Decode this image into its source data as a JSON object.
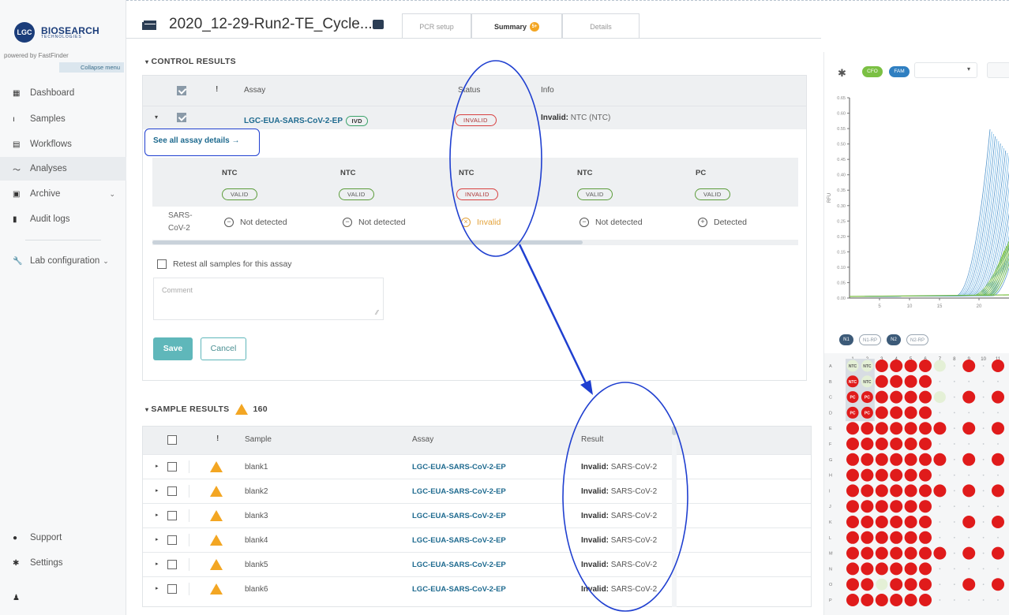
{
  "app": {
    "logo_mark": "LGC",
    "logo_name": "BIOSEARCH",
    "logo_sub": "TECHNOLOGIES",
    "powered_by": "powered by FastFinder",
    "collapse_label": "Collapse menu"
  },
  "sidebar": {
    "items": [
      {
        "label": "Dashboard",
        "icon": "dashboard-icon"
      },
      {
        "label": "Samples",
        "icon": "samples-icon"
      },
      {
        "label": "Workflows",
        "icon": "workflows-icon"
      },
      {
        "label": "Analyses",
        "icon": "analyses-icon"
      },
      {
        "label": "Archive",
        "icon": "archive-icon"
      },
      {
        "label": "Audit logs",
        "icon": "audit-logs-icon"
      },
      {
        "label": "Lab configuration",
        "icon": "wrench-icon"
      }
    ],
    "bottom": [
      {
        "label": "Support",
        "icon": "help-icon"
      },
      {
        "label": "Settings",
        "icon": "gear-icon"
      }
    ]
  },
  "header": {
    "run_title": "2020_12-29-Run2-TE_Cycle...",
    "tabs": [
      {
        "label": "PCR setup"
      },
      {
        "label": "Summary",
        "badge": "5+"
      },
      {
        "label": "Details"
      }
    ]
  },
  "control_results": {
    "title": "CONTROL RESULTS",
    "headers": {
      "flag": "!",
      "assay": "Assay",
      "status": "Status",
      "info": "Info"
    },
    "row": {
      "assay": "LGC-EUA-SARS-CoV-2-EP",
      "assay_tag": "IVD",
      "status": "INVALID",
      "info_bold": "Invalid:",
      "info_text": "NTC (NTC)"
    },
    "see_all": "See all assay details →",
    "columns": [
      {
        "name": "NTC",
        "status": "VALID",
        "result": "Not detected",
        "kind": "not"
      },
      {
        "name": "NTC",
        "status": "VALID",
        "result": "Not detected",
        "kind": "not"
      },
      {
        "name": "NTC",
        "status": "INVALID",
        "result": "Invalid",
        "kind": "invalid"
      },
      {
        "name": "NTC",
        "status": "VALID",
        "result": "Not detected",
        "kind": "not"
      },
      {
        "name": "PC",
        "status": "VALID",
        "result": "Detected",
        "kind": "det"
      }
    ],
    "target_line1": "SARS-",
    "target_line2": "CoV-2",
    "retest_label": "Retest all samples for this assay",
    "comment_placeholder": "Comment",
    "save_label": "Save",
    "cancel_label": "Cancel"
  },
  "sample_results": {
    "title": "SAMPLE RESULTS",
    "count": "160",
    "headers": {
      "flag": "!",
      "sample": "Sample",
      "assay": "Assay",
      "result": "Result"
    },
    "rows": [
      {
        "sample": "blank1",
        "assay": "LGC-EUA-SARS-CoV-2-EP",
        "result_bold": "Invalid:",
        "result_text": "SARS-CoV-2"
      },
      {
        "sample": "blank2",
        "assay": "LGC-EUA-SARS-CoV-2-EP",
        "result_bold": "Invalid:",
        "result_text": "SARS-CoV-2"
      },
      {
        "sample": "blank3",
        "assay": "LGC-EUA-SARS-CoV-2-EP",
        "result_bold": "Invalid:",
        "result_text": "SARS-CoV-2"
      },
      {
        "sample": "blank4",
        "assay": "LGC-EUA-SARS-CoV-2-EP",
        "result_bold": "Invalid:",
        "result_text": "SARS-CoV-2"
      },
      {
        "sample": "blank5",
        "assay": "LGC-EUA-SARS-CoV-2-EP",
        "result_bold": "Invalid:",
        "result_text": "SARS-CoV-2"
      },
      {
        "sample": "blank6",
        "assay": "LGC-EUA-SARS-CoV-2-EP",
        "result_bold": "Invalid:",
        "result_text": "SARS-CoV-2"
      }
    ]
  },
  "right_panel": {
    "channels": [
      {
        "label": "CFO",
        "color": "#7bc043"
      },
      {
        "label": "FAM",
        "color": "#2f7fc1"
      }
    ],
    "plot": {
      "ylabel": "RFU",
      "yticks": [
        "0.65",
        "0.60",
        "0.55",
        "0.50",
        "0.45",
        "0.40",
        "0.35",
        "0.30",
        "0.25",
        "0.20",
        "0.15",
        "0.10",
        "0.05",
        "0.00"
      ],
      "xticks": [
        "5",
        "10",
        "15",
        "20"
      ]
    },
    "well_chips": [
      "N1",
      "N1-RP",
      "N2",
      "N2-RP"
    ],
    "plate": {
      "columns": [
        "1",
        "2",
        "3",
        "4",
        "5",
        "6",
        "7",
        "8",
        "9",
        "10",
        "11"
      ],
      "rows": [
        "A",
        "B",
        "C",
        "D",
        "E",
        "F",
        "G",
        "H",
        "I",
        "J",
        "K",
        "L",
        "M",
        "N",
        "O",
        "P"
      ],
      "label_ntc": "NTC",
      "label_pc": "PC",
      "well_red": "#e01b1b",
      "well_pale": "#e4f0d6"
    }
  },
  "colors": {
    "accent": "#5fb7ba",
    "link": "#1e6a8f",
    "annotation": "#1f3fd0",
    "warning": "#f3a623",
    "invalid": "#d84040"
  }
}
